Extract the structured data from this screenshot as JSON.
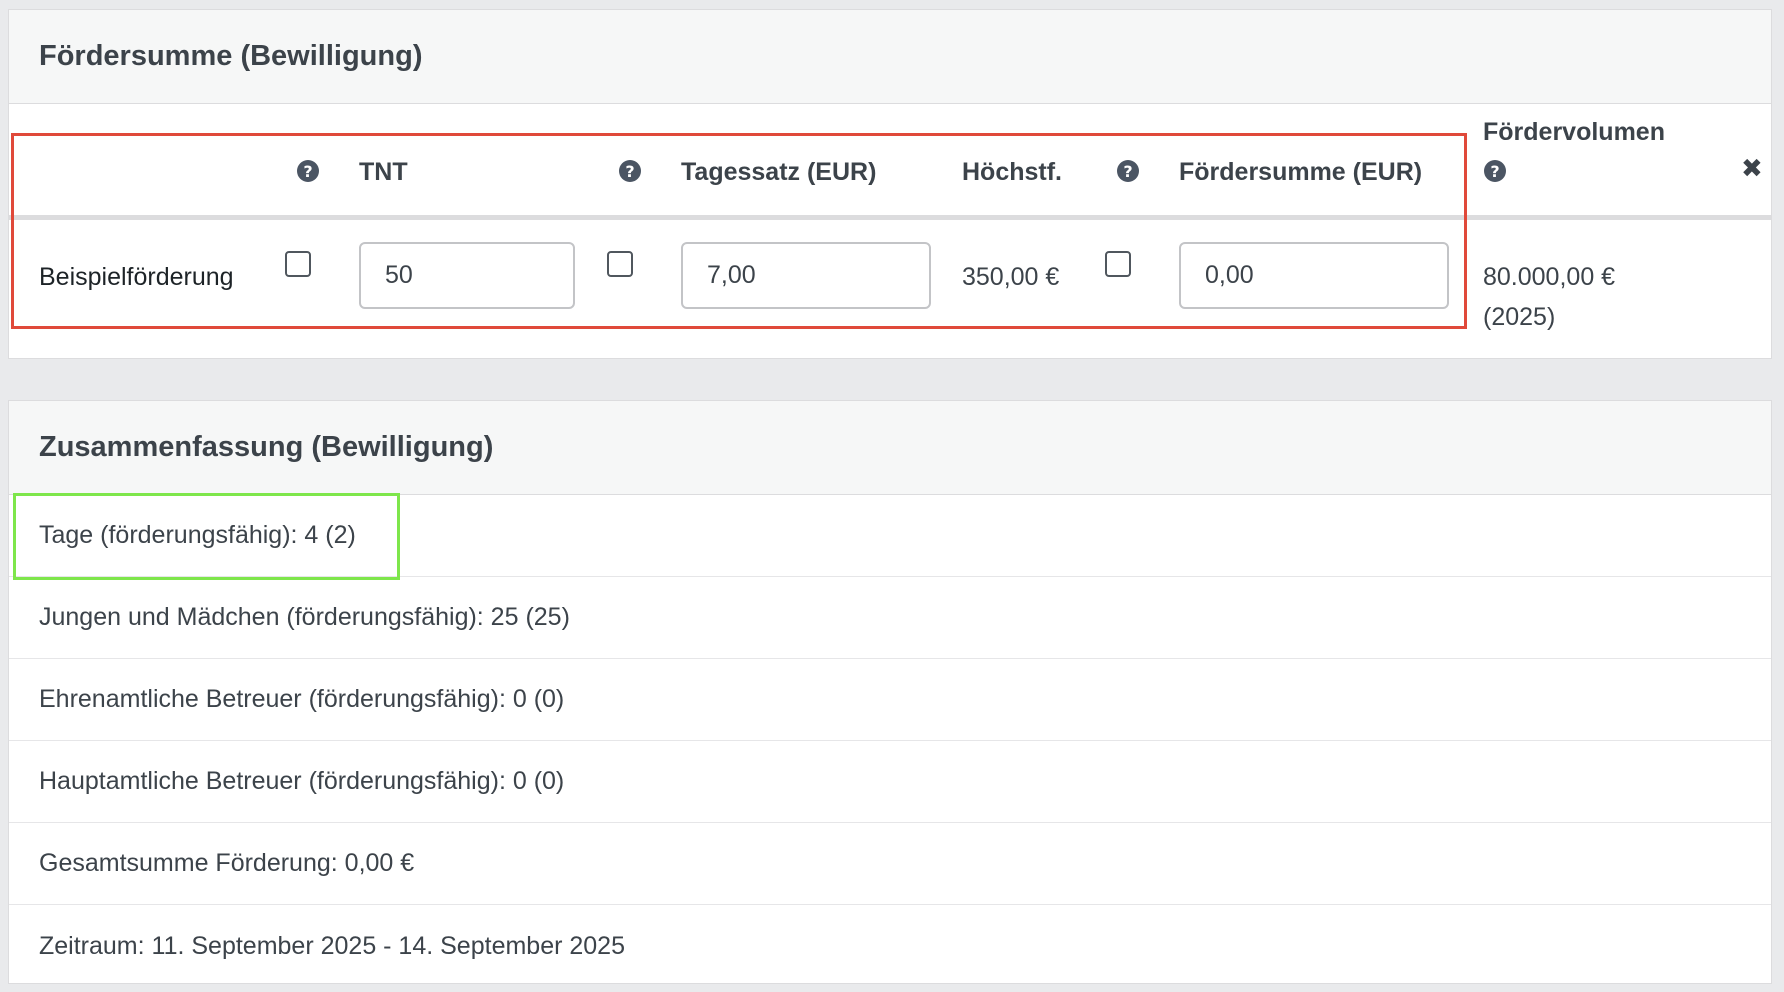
{
  "foerdersumme_panel": {
    "title": "Fördersumme (Bewilligung)",
    "columns": {
      "tnt": "TNT",
      "tagessatz": "Tagessatz (EUR)",
      "hoechstf": "Höchstf.",
      "foerdersumme": "Fördersumme (EUR)",
      "foerdervolumen_line1": "Fördervolumen",
      "help_glyph": "?",
      "remove_glyph": "✖"
    },
    "row": {
      "label": "Beispielförderung",
      "tnt_value": "50",
      "tagessatz_value": "7,00",
      "hoechstf_value": "350,00 €",
      "foerdersumme_value": "0,00",
      "foerdervolumen_amount": "80.000,00 €",
      "foerdervolumen_year": "(2025)"
    }
  },
  "summary_panel": {
    "title": "Zusammenfassung (Bewilligung)",
    "items": [
      "Tage (förderungsfähig): 4 (2)",
      "Jungen und Mädchen (förderungsfähig): 25 (25)",
      "Ehrenamtliche Betreuer (förderungsfähig): 0 (0)",
      "Hauptamtliche Betreuer (förderungsfähig): 0 (0)",
      "Gesamtsumme Förderung: 0,00 €",
      "Zeitraum: 11. September 2025 - 14. September 2025"
    ]
  },
  "colors": {
    "highlight_red": "#e0493a",
    "highlight_green": "#7ee64b",
    "panel_header_bg": "#f6f7f7",
    "page_bg": "#e9eaec"
  }
}
